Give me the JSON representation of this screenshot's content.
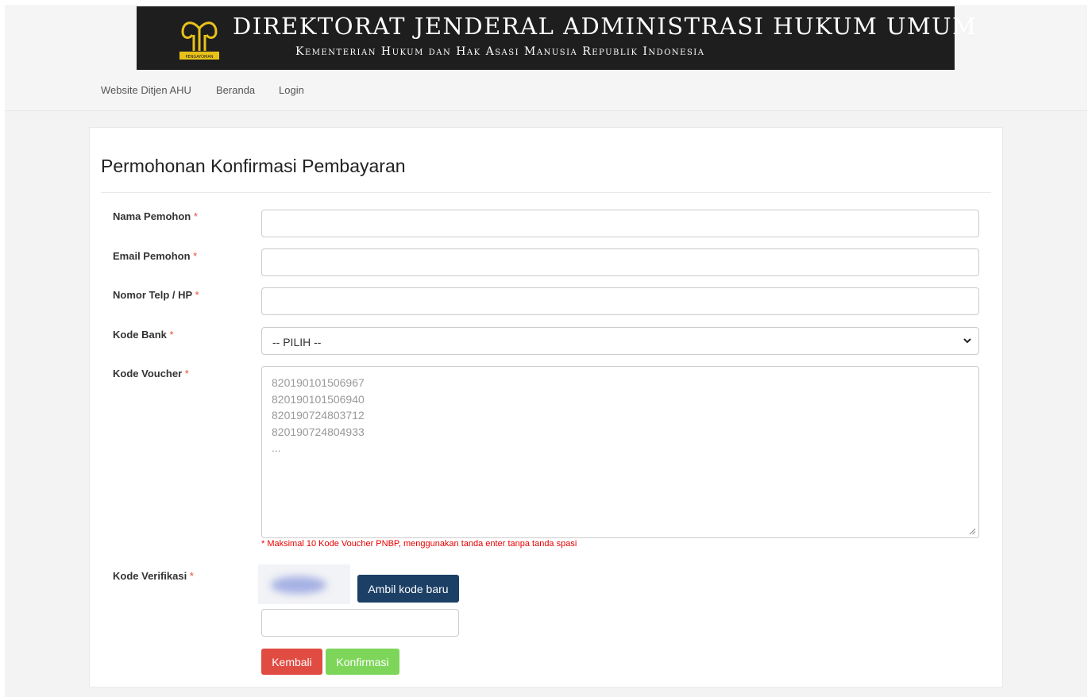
{
  "header": {
    "title": "DIREKTORAT JENDERAL ADMINISTRASI HUKUM UMUM",
    "subtitle": "Kementerian Hukum dan Hak Asasi Manusia Republik Indonesia",
    "logo_icon": "pengayoman-logo",
    "logo_caption": "PENGAYOMAN"
  },
  "nav": {
    "items": [
      "Website Ditjen AHU",
      "Beranda",
      "Login"
    ]
  },
  "form": {
    "title": "Permohonan Konfirmasi Pembayaran",
    "required_marker": "*",
    "fields": {
      "nama": {
        "label": "Nama Pemohon",
        "value": ""
      },
      "email": {
        "label": "Email Pemohon",
        "value": ""
      },
      "telp": {
        "label": "Nomor Telp / HP",
        "value": ""
      },
      "bank": {
        "label": "Kode Bank",
        "selected": "-- PILIH --"
      },
      "voucher": {
        "label": "Kode Voucher",
        "placeholder_lines": [
          "820190101506967",
          "820190101506940",
          "820190724803712",
          "820190724804933",
          "..."
        ],
        "hint": "* Maksimal 10 Kode Voucher PNBP, menggunakan tanda enter tanpa tanda spasi"
      },
      "verifikasi": {
        "label": "Kode Verifikasi",
        "refresh_label": "Ambil kode baru",
        "value": ""
      }
    },
    "buttons": {
      "back_label": "Kembali",
      "confirm_label": "Konfirmasi"
    }
  },
  "colors": {
    "banner_bg": "#1e1e1e",
    "logo_gold": "#e8c21a",
    "required": "#e74c3c",
    "hint": "#e60000",
    "refresh_button": "#1c3f66",
    "back_button": "#e04b42",
    "confirm_button": "#7dd65a"
  }
}
